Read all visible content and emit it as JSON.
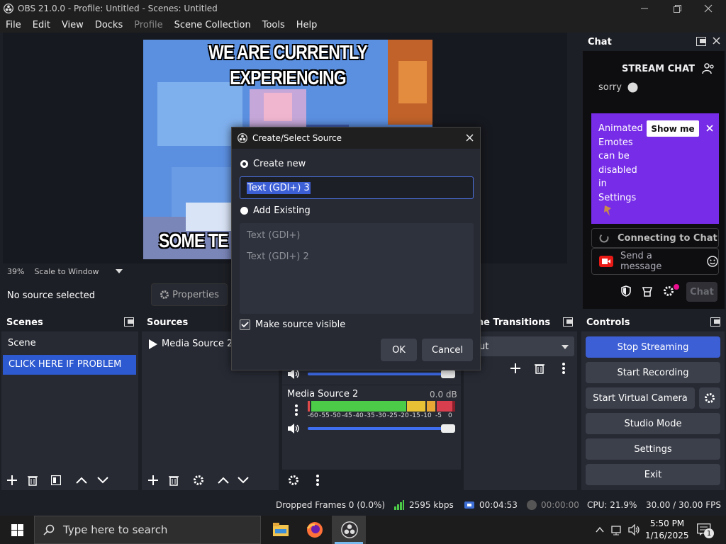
{
  "titlebar": {
    "title": "OBS 21.0.0 - Profile: Untitled - Scenes: Untitled"
  },
  "menubar": {
    "items": [
      "File",
      "Edit",
      "View",
      "Docks",
      "Profile",
      "Scene Collection",
      "Tools",
      "Help"
    ]
  },
  "preview": {
    "meme_top_1": "WE ARE CURRENTLY",
    "meme_top_2": "EXPERIENCING",
    "meme_bottom": "SOME TE"
  },
  "zoom": {
    "percent": "39%",
    "mode": "Scale to Window"
  },
  "source_toolbar": {
    "status": "No source selected",
    "properties": "Properties"
  },
  "chat": {
    "title": "Chat",
    "header": "STREAM CHAT",
    "partial_msg": "sorry",
    "promo_text": "Animated Emotes can be disabled in Settings",
    "promo_button": "Show me",
    "connecting": "Connecting to Chat",
    "send_placeholder": "Send a message",
    "chat_button": "Chat"
  },
  "scenes": {
    "title": "Scenes",
    "items": [
      "Scene",
      "CLICK HERE IF PROBLEM"
    ]
  },
  "sources": {
    "title": "Sources",
    "items": [
      "Media Source 2"
    ]
  },
  "mixer": {
    "track_name": "Media Source 2",
    "track_db": "0.0 dB",
    "ticks": [
      "-60",
      "-55",
      "-50",
      "-45",
      "-40",
      "-35",
      "-30",
      "-25",
      "-20",
      "-15",
      "-10",
      "-5",
      "0"
    ]
  },
  "transitions": {
    "title": "ene Transitions",
    "selected": "ut"
  },
  "controls": {
    "title": "Controls",
    "stop_streaming": "Stop Streaming",
    "start_recording": "Start Recording",
    "start_virtual_camera": "Start Virtual Camera",
    "studio_mode": "Studio Mode",
    "settings": "Settings",
    "exit": "Exit"
  },
  "dialog": {
    "title": "Create/Select Source",
    "create_new": "Create new",
    "name_value": "Text (GDI+) 3",
    "add_existing": "Add Existing",
    "existing": [
      "Text (GDI+)",
      "Text (GDI+) 2"
    ],
    "make_visible": "Make source visible",
    "ok": "OK",
    "cancel": "Cancel"
  },
  "status": {
    "dropped": "Dropped Frames 0 (0.0%)",
    "bitrate": "2595 kbps",
    "stream_time": "00:04:53",
    "rec_time": "00:00:00",
    "cpu": "CPU: 21.9%",
    "fps": "30.00 / 30.00 FPS"
  },
  "taskbar": {
    "search": "Type here to search",
    "time": "5:50 PM",
    "date": "1/16/2025",
    "notif_count": "1"
  },
  "colors": {
    "accent_blue": "#3d5fd6",
    "selected_scene": "#2d5ad1",
    "twitch_purple": "#772ce8"
  }
}
